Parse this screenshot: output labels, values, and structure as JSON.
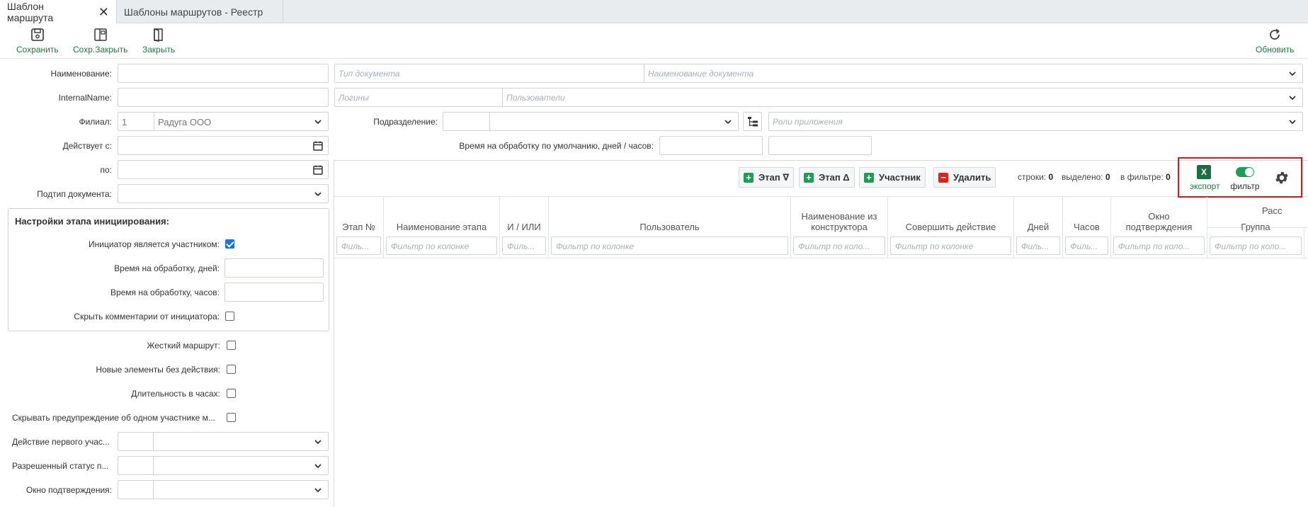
{
  "tabs": [
    {
      "label": "Шаблон маршрута",
      "close": "✕"
    },
    {
      "label": "Шаблоны маршрутов - Реестр",
      "close": ""
    }
  ],
  "toolbar": {
    "save": "Сохранить",
    "save_close": "Сохр.Закрыть",
    "close": "Закрыть",
    "refresh": "Обновить"
  },
  "form": {
    "name_label": "Наименование:",
    "internal_label": "InternalName:",
    "branch_label": "Филиал:",
    "branch_code": "1",
    "branch_name": "Радуга ООО",
    "valid_from_label": "Действует с:",
    "valid_to_label": "по:",
    "subtype_label": "Подтип документа:",
    "doc_type_ph": "Тип документа",
    "doc_name_ph": "Наименование документа",
    "logins_ph": "Логины",
    "users_ph": "Пользователи",
    "division_label": "Подразделение:",
    "roles_ph": "Роли приложения",
    "default_time_label": "Время на обработку по умолчанию, дней / часов:"
  },
  "init": {
    "title": "Настройки этапа инициирования:",
    "initiator_participant": "Инициатор является участником:",
    "time_days": "Время на обработку, дней:",
    "time_hours": "Время на обработку, часов:",
    "hide_comments": "Скрыть комментарии от инициатора:"
  },
  "options": {
    "strict_route": "Жесткий маршрут:",
    "new_no_action": "Новые элементы без действия:",
    "duration_hours": "Длительность в часах:",
    "hide_warning": "Скрывать предупреждение об одном участнике м...",
    "first_action": "Действие первого учас...",
    "allowed_status": "Разрешенный статус п...",
    "confirm_window": "Окно подтверждения:"
  },
  "grid": {
    "btn_stage_down": "Этап ∇",
    "btn_stage_up": "Этап Δ",
    "btn_participant": "Участник",
    "btn_delete": "Удалить",
    "rows_label": "строки:",
    "rows_val": "0",
    "selected_label": "выделено:",
    "selected_val": "0",
    "filtered_label": "в фильтре:",
    "filtered_val": "0",
    "export_label": "экспорт",
    "excel_glyph": "X",
    "filter_label": "фильтр",
    "group_header": "Расс",
    "columns": [
      {
        "title": "Этап №",
        "filter": "Филь..."
      },
      {
        "title": "Наименование этапа",
        "filter": "Фильтр по колонке"
      },
      {
        "title": "И / ИЛИ",
        "filter": "Филь..."
      },
      {
        "title": "Пользователь",
        "filter": "Фильтр по колонке"
      },
      {
        "title": "Наименование из конструктора",
        "filter": "Фильтр по коло..."
      },
      {
        "title": "Совершить действие",
        "filter": "Фильтр по колонке"
      },
      {
        "title": "Дней",
        "filter": "Филь..."
      },
      {
        "title": "Часов",
        "filter": "Филь..."
      },
      {
        "title": "Окно подтверждения",
        "filter": "Фильтр по коло..."
      },
      {
        "title": "Группа",
        "filter": "Фильтр по коло..."
      }
    ]
  },
  "colors": {
    "accent_green": "#1f7a3a",
    "highlight_red": "#e0141e",
    "checkbox_blue": "#1a73e8"
  }
}
